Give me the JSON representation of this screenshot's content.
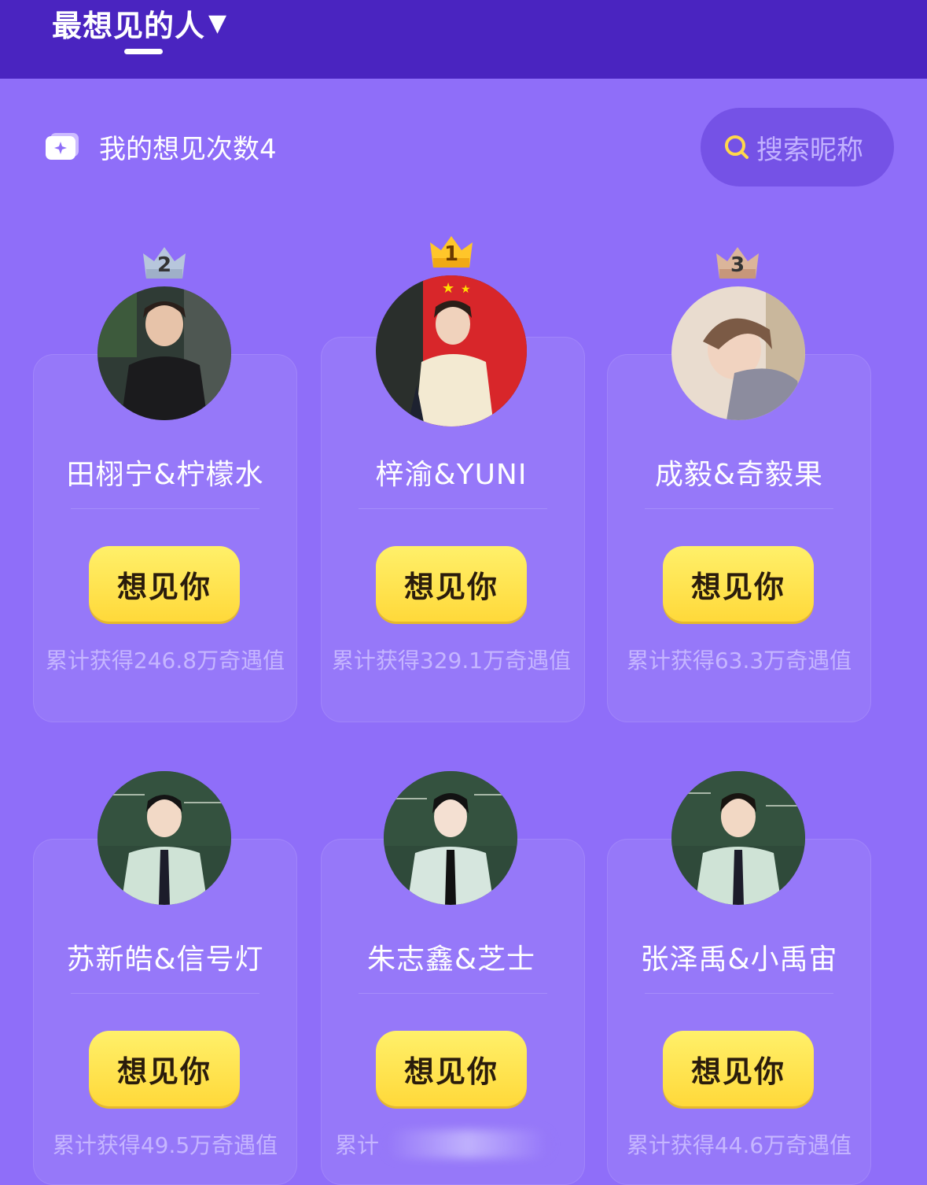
{
  "header": {
    "tab_title": "最想见的人",
    "tab_caret": "▼"
  },
  "counter": {
    "text": "我的想见次数4",
    "icon": "ticket-icon"
  },
  "search": {
    "placeholder": "搜索昵称",
    "icon": "search-icon"
  },
  "colors": {
    "header_bg": "#4a24c0",
    "page_bg": "#8f6ef9",
    "button_yellow": "#ffe54a"
  },
  "cards": [
    {
      "rank": "2",
      "name": "田栩宁&柠檬水",
      "button": "想见你",
      "score": "累计获得246.8万奇遇值"
    },
    {
      "rank": "1",
      "name": "梓渝&YUNI",
      "button": "想见你",
      "score": "累计获得329.1万奇遇值"
    },
    {
      "rank": "3",
      "name": "成毅&奇毅果",
      "button": "想见你",
      "score": "累计获得63.3万奇遇值"
    },
    {
      "rank": "",
      "name": "苏新皓&信号灯",
      "button": "想见你",
      "score": "累计获得49.5万奇遇值"
    },
    {
      "rank": "",
      "name": "朱志鑫&芝士",
      "button": "想见你",
      "score": "累计"
    },
    {
      "rank": "",
      "name": "张泽禹&小禹宙",
      "button": "想见你",
      "score": "累计获得44.6万奇遇值"
    }
  ]
}
